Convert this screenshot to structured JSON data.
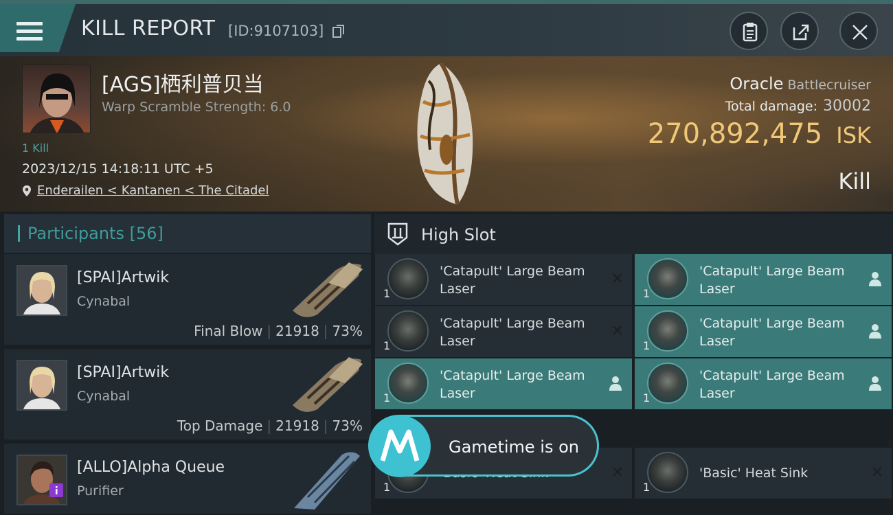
{
  "header": {
    "title": "KILL REPORT",
    "report_id": "[ID:9107103]",
    "icons": [
      "menu-icon",
      "clipboard-icon",
      "share-icon",
      "close-icon"
    ]
  },
  "victim": {
    "name": "[AGS]栖利普贝当",
    "warp_scramble": "Warp Scramble Strength: 6.0",
    "kills": "1 Kill",
    "datetime": "2023/12/15 14:18:11 UTC +5",
    "location": "Enderailen < Kantanen < The Citadel",
    "ship_name": "Oracle",
    "ship_class": "Battlecruiser",
    "total_damage_label": "Total damage:",
    "total_damage": "30002",
    "isk_value": "270,892,475",
    "isk_unit": "ISK",
    "result": "Kill"
  },
  "participants": {
    "label": "Participants",
    "count": "[56]",
    "rows": [
      {
        "name": "[SPAI]Artwik",
        "ship": "Cynabal",
        "role": "Final Blow",
        "damage": "21918",
        "percent": "73%"
      },
      {
        "name": "[SPAI]Artwik",
        "ship": "Cynabal",
        "role": "Top Damage",
        "damage": "21918",
        "percent": "73%"
      },
      {
        "name": "[ALLO]Alpha Queue",
        "ship": "Purifier",
        "badge": "i"
      }
    ]
  },
  "high_slot": {
    "label": "High Slot",
    "items": [
      {
        "name": "'Catapult' Large Beam Laser",
        "qty": "1",
        "status": "destroyed"
      },
      {
        "name": "'Catapult' Large Beam Laser",
        "qty": "1",
        "status": "dropped"
      },
      {
        "name": "'Catapult' Large Beam Laser",
        "qty": "1",
        "status": "destroyed"
      },
      {
        "name": "'Catapult' Large Beam Laser",
        "qty": "1",
        "status": "dropped"
      },
      {
        "name": "'Catapult' Large Beam Laser",
        "qty": "1",
        "status": "dropped"
      },
      {
        "name": "'Catapult' Large Beam Laser",
        "qty": "1",
        "status": "dropped"
      },
      {
        "name": "'Basic' Heat Sink",
        "qty": "1",
        "status": "destroyed"
      },
      {
        "name": "'Basic' Heat Sink",
        "qty": "1",
        "status": "destroyed"
      }
    ]
  },
  "toast": {
    "text": "Gametime is on",
    "icon": "motorola-logo"
  },
  "colors": {
    "accent": "#3fa9a6",
    "isk": "#f0c878",
    "dropped": "#3a7a78",
    "toast_border": "#49c3cf"
  }
}
